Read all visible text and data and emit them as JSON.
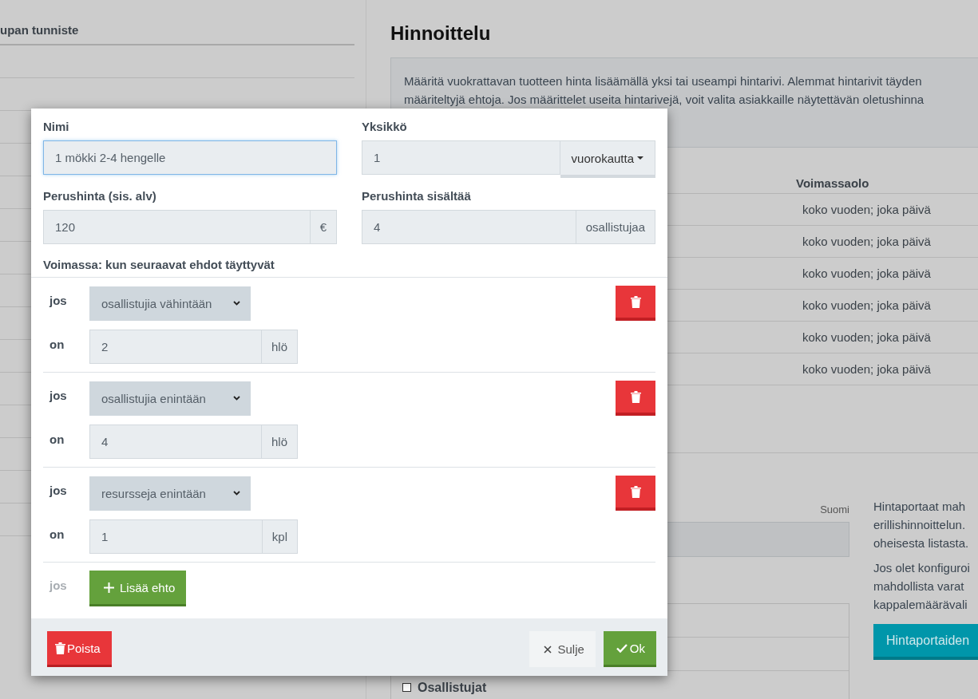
{
  "left_column": {
    "heading": "upan tunniste"
  },
  "pricing": {
    "title": "Hinnoittelu",
    "info_lines": [
      "Määritä vuokrattavan tuotteen hinta lisäämällä yksi tai useampi hintarivi. Alemmat hintarivit täyden",
      "määriteltyjä ehtoja. Jos määrittelet useita hintarivejä, voit valita asiakkaille näytettävän oletushinna"
    ],
    "table": {
      "columns": [
        "Voimassaolo"
      ],
      "rows": [
        {
          "validity": "koko vuoden; joka päivä"
        },
        {
          "validity": "koko vuoden; joka päivä"
        },
        {
          "validity": "koko vuoden; joka päivä"
        },
        {
          "validity": "koko vuoden; joka päivä"
        },
        {
          "validity": "koko vuoden; joka päivä"
        },
        {
          "validity": "koko vuoden; joka päivä"
        }
      ]
    }
  },
  "language_label": "Suomi",
  "help_paragraphs": [
    [
      "Hintaportaat mah",
      "erillishinnoittelun.",
      "oheisesta listasta."
    ],
    [
      "Jos olet konfiguroi",
      "mahdollista varat",
      "kappalemäärävali"
    ]
  ],
  "tiers_button": "Hintaportaiden",
  "list_items": [
    {
      "label": "Osallistujat",
      "checked": false
    }
  ],
  "dialog": {
    "fields": [
      {
        "kind": "text",
        "label": "Nimi",
        "value": "1 mökki 2-4 hengelle",
        "focused": true
      },
      {
        "kind": "dropdown",
        "label": "Yksikkö",
        "value": "1",
        "dropdown": "vuorokautta",
        "focused": false
      },
      {
        "kind": "addon",
        "label": "Perushinta (sis. alv)",
        "value": "120",
        "addon": "€",
        "focused": false
      },
      {
        "kind": "addon",
        "label": "Perushinta sisältää",
        "value": "4",
        "addon": "osallistujaa",
        "focused": false
      }
    ],
    "conditions_title": "Voimassa: kun seuraavat ehdot täyttyvät",
    "conditions": [
      {
        "if_label": "jos",
        "select": "osallistujia vähintään",
        "is_label": "on",
        "value": "2",
        "unit": "hlö"
      },
      {
        "if_label": "jos",
        "select": "osallistujia enintään",
        "is_label": "on",
        "value": "4",
        "unit": "hlö"
      },
      {
        "if_label": "jos",
        "select": "resursseja enintään",
        "is_label": "on",
        "value": "1",
        "unit": "kpl"
      }
    ],
    "add_row": {
      "if_label": "jos",
      "button": "Lisää ehto"
    },
    "footer": {
      "delete": "Poista",
      "close": "Sulje",
      "ok": "Ok"
    }
  }
}
